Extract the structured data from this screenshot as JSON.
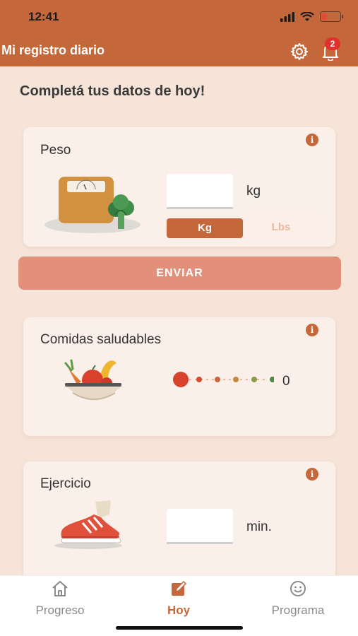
{
  "status": {
    "time": "12:41"
  },
  "header": {
    "title": "Mi registro diario",
    "notification_count": "2"
  },
  "page": {
    "heading": "Completá tus datos de hoy!"
  },
  "weight": {
    "title": "Peso",
    "info": "i",
    "value": "",
    "unit": "kg",
    "unit_options": [
      "Kg",
      "Lbs"
    ],
    "selected_unit": "Kg"
  },
  "submit": {
    "label": "ENVIAR"
  },
  "meals": {
    "title": "Comidas saludables",
    "info": "i",
    "value": "0",
    "dot_colors": [
      "#d7442e",
      "#d24a32",
      "#c9683a",
      "#c58a3e",
      "#8b9a48",
      "#4e8a3e"
    ]
  },
  "exercise": {
    "title": "Ejercicio",
    "info": "i",
    "value": "",
    "unit": "min."
  },
  "tabs": [
    {
      "label": "Progreso",
      "icon": "home-icon",
      "active": false
    },
    {
      "label": "Hoy",
      "icon": "edit-icon",
      "active": true
    },
    {
      "label": "Programa",
      "icon": "smiley-icon",
      "active": false
    }
  ],
  "colors": {
    "brand": "#c4673a",
    "background": "#f6e4d9",
    "card": "#fbf0e9",
    "button": "#e2907a",
    "tab_inactive": "#8a8a8a"
  }
}
